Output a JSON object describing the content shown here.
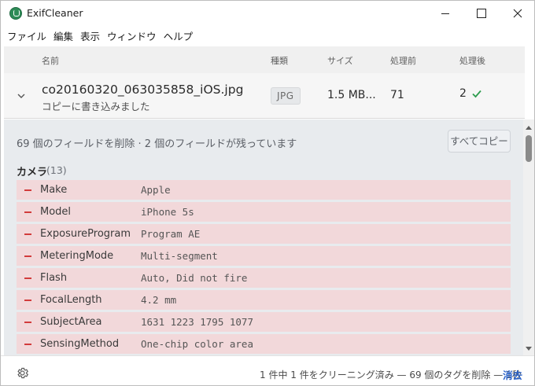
{
  "window": {
    "title": "ExifCleaner"
  },
  "menu": [
    "ファイル",
    "編集",
    "表示",
    "ウィンドウ",
    "ヘルプ"
  ],
  "columns": {
    "name": "名前",
    "type": "種類",
    "size": "サイズ",
    "before": "処理前",
    "after": "処理後"
  },
  "file": {
    "name": "co20160320_063035858_iOS.jpg",
    "status": "コピーに書き込みました",
    "type": "JPG",
    "size": "1.5 MB...",
    "before": "71",
    "after": "2"
  },
  "details": {
    "summary": "69 個のフィールドを削除 · 2 個のフィールドが残っています",
    "copy_all": "すべてコピー",
    "group": {
      "title": "カメラ",
      "count": "(13)"
    },
    "tags": [
      {
        "name": "Make",
        "value": "Apple"
      },
      {
        "name": "Model",
        "value": "iPhone 5s"
      },
      {
        "name": "ExposureProgram",
        "value": "Program AE"
      },
      {
        "name": "MeteringMode",
        "value": "Multi-segment"
      },
      {
        "name": "Flash",
        "value": "Auto, Did not fire"
      },
      {
        "name": "FocalLength",
        "value": "4.2 mm"
      },
      {
        "name": "SubjectArea",
        "value": "1631 1223 1795 1077"
      },
      {
        "name": "SensingMethod",
        "value": "One-chip color area"
      }
    ]
  },
  "statusbar": {
    "text": "1 件中 1 件をクリーニング済み — 69 個のタグを削除 — 1秒",
    "clear": "消去"
  },
  "colors": {
    "removed_row": "#f2d8da",
    "minus": "#d23c3c",
    "check": "#2e9d4f",
    "link": "#2a62c9"
  }
}
